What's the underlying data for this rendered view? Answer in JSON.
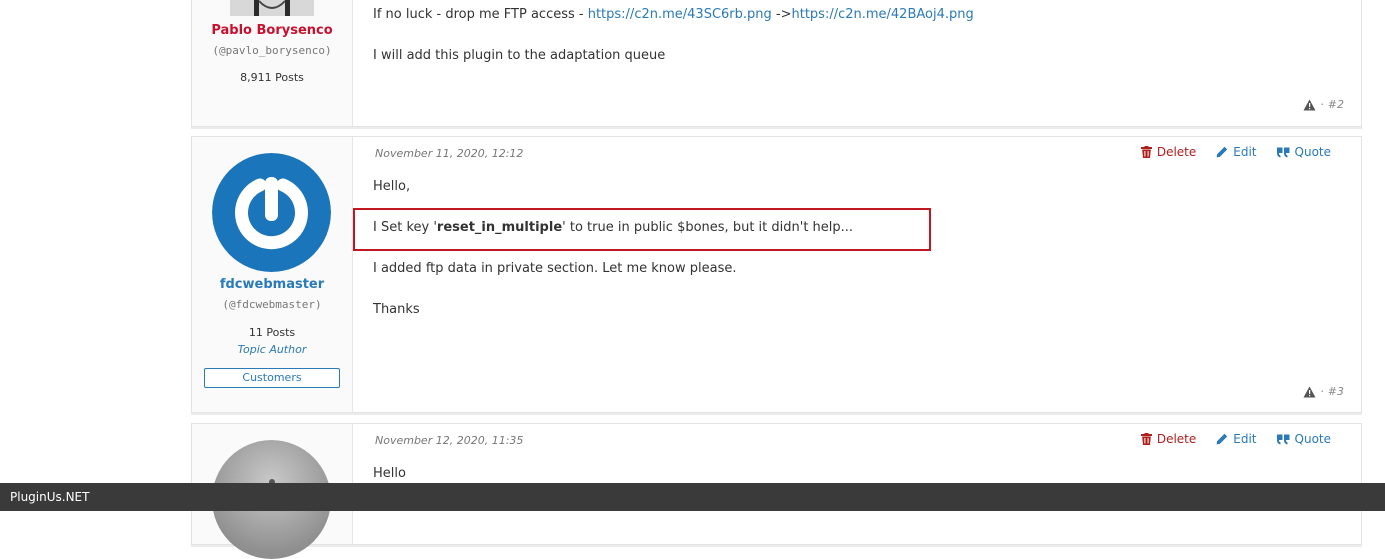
{
  "posts": [
    {
      "author": {
        "name": "Pablo Borysenco",
        "handle": "(@pavlo_borysenco)",
        "posts": "8,911 Posts"
      },
      "lines": {
        "ftp_prefix": "If  no  luck  - drop  me  FTP access - ",
        "link1": "https://c2n.me/43SC6rb.png",
        "arrow": " ->",
        "link2": "https://c2n.me/42BAoj4.png",
        "line2": "I will add this plugin to the adaptation queue"
      },
      "number": "#2"
    },
    {
      "author": {
        "name": "fdcwebmaster",
        "handle": "(@fdcwebmaster)",
        "posts": "11 Posts",
        "role": "Topic Author",
        "badge": "Customers"
      },
      "date": "November 11, 2020, 12:12",
      "actions": {
        "delete": "Delete",
        "edit": "Edit",
        "quote": "Quote"
      },
      "lines": {
        "greeting": "Hello,",
        "set_key_prefix": "I Set key '",
        "set_key_bold": "reset_in_multiple",
        "set_key_suffix": "' to true in public $bones, but it didn't help...",
        "ftp_added": "I added ftp data in private section. Let me know please.",
        "thanks": "Thanks"
      },
      "number": "#3"
    },
    {
      "date": "November 12, 2020, 11:35",
      "actions": {
        "delete": "Delete",
        "edit": "Edit",
        "quote": "Quote"
      },
      "lines": {
        "greeting": "Hello"
      }
    }
  ],
  "footer": {
    "site": "PluginUs.NET"
  },
  "icons": {
    "delete": "trash-icon",
    "edit": "pencil-icon",
    "quote": "quote-icon",
    "report": "warning-icon"
  },
  "colors": {
    "admin_name": "#c8102e",
    "link": "#2a7ab8",
    "delete": "#b01e1e",
    "highlight_border": "#c0181e",
    "footer_bg": "#3a3a3a"
  }
}
